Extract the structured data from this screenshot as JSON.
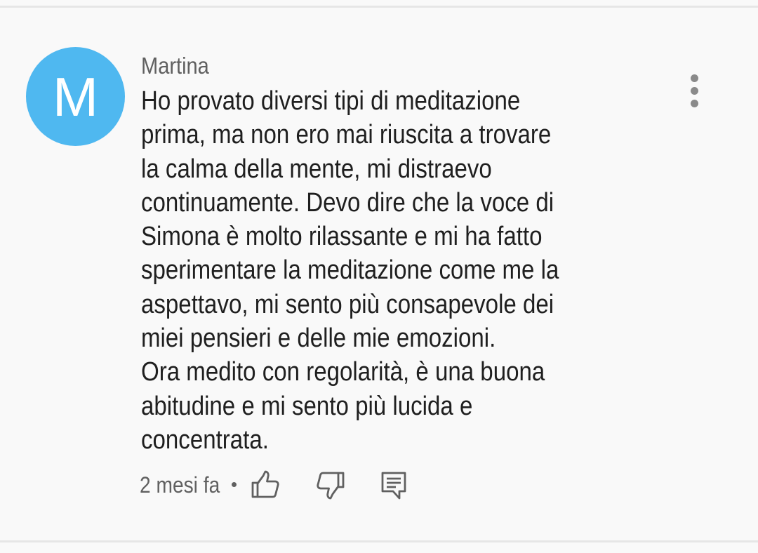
{
  "comment": {
    "avatar_letter": "M",
    "avatar_color": "#4fb8f0",
    "author": "Martina",
    "text": "Ho provato diversi tipi di meditazione\nprima, ma non ero mai riuscita a trovare\nla calma della mente, mi distraevo\ncontinuamente. Devo dire che la voce di\nSimona è molto rilassante e mi ha fatto\nsperimentare la meditazione come me la\naspettavo, mi sento più consapevole dei\nmiei pensieri e delle mie emozioni.\nOra medito con regolarità, è una buona\nabitudine e mi sento più lucida e\nconcentrata.",
    "timestamp": "2 mesi fa",
    "separator": "•"
  },
  "actions": {
    "like_icon": "thumbs-up-icon",
    "dislike_icon": "thumbs-down-icon",
    "reply_icon": "comment-icon",
    "more_icon": "more-vert-icon"
  }
}
